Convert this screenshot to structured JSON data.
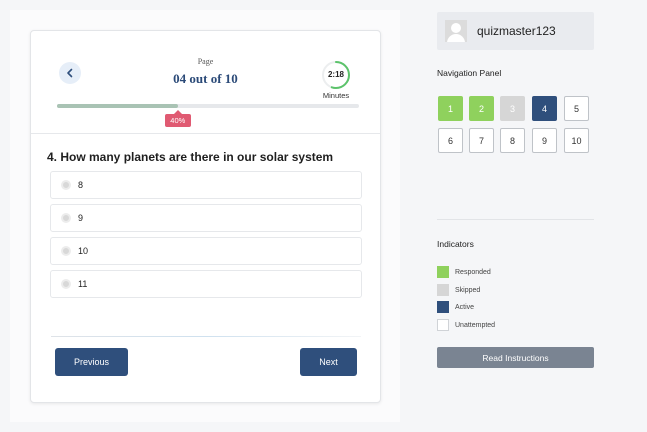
{
  "quiz": {
    "page_label": "Page",
    "page_count": "04 out of 10",
    "timer": {
      "time": "2:18",
      "unit": "Minutes",
      "fraction_remaining": 0.55
    },
    "progress": {
      "percent_value": 40,
      "label": "40%"
    },
    "question": "4.  How many planets are there in our solar system",
    "options": [
      "8",
      "9",
      "10",
      "11"
    ],
    "buttons": {
      "previous": "Previous",
      "next": "Next"
    }
  },
  "user": {
    "username": "quizmaster123"
  },
  "navigation": {
    "title": "Navigation Panel",
    "items": [
      {
        "label": "1",
        "status": "responded"
      },
      {
        "label": "2",
        "status": "responded"
      },
      {
        "label": "3",
        "status": "skipped"
      },
      {
        "label": "4",
        "status": "active"
      },
      {
        "label": "5",
        "status": "unattempted"
      },
      {
        "label": "6",
        "status": "unattempted"
      },
      {
        "label": "7",
        "status": "unattempted"
      },
      {
        "label": "8",
        "status": "unattempted"
      },
      {
        "label": "9",
        "status": "unattempted"
      },
      {
        "label": "10",
        "status": "unattempted"
      }
    ]
  },
  "indicators": {
    "title": "Indicators",
    "items": [
      {
        "label": "Responded",
        "color": "#8fd15d"
      },
      {
        "label": "Skipped",
        "color": "#d6d6d6"
      },
      {
        "label": "Active",
        "color": "#2f4f7c"
      },
      {
        "label": "Unattempted",
        "color": "#ffffff"
      }
    ]
  },
  "read_instructions": "Read Instructions",
  "colors": {
    "accent": "#2f4f7c",
    "responded": "#8fd15d",
    "badge": "#e05a72",
    "timer_ring": "#5cc36b"
  },
  "icons": {
    "back": "chevron-left-icon",
    "avatar": "user-avatar-icon"
  }
}
